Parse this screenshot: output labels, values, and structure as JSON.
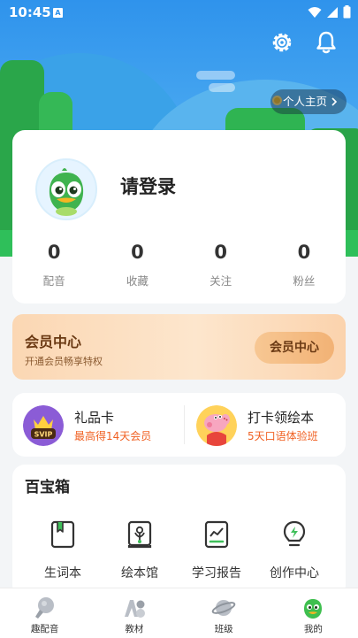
{
  "status_bar": {
    "time": "10:45",
    "sim_label": "A"
  },
  "header": {
    "home_link_label": "个人主页"
  },
  "profile": {
    "login_label": "请登录",
    "stats": [
      {
        "value": "0",
        "label": "配音"
      },
      {
        "value": "0",
        "label": "收藏"
      },
      {
        "value": "0",
        "label": "关注"
      },
      {
        "value": "0",
        "label": "粉丝"
      }
    ]
  },
  "vip": {
    "title": "会员中心",
    "subtitle": "开通会员畅享特权",
    "button_label": "会员中心"
  },
  "promo": {
    "gift": {
      "title": "礼品卡",
      "subtitle": "最高得14天会员",
      "badge": "SVIP"
    },
    "checkin": {
      "title": "打卡领绘本",
      "subtitle": "5天口语体验班"
    }
  },
  "toolbox": {
    "title": "百宝箱",
    "items": [
      {
        "label": "生词本",
        "icon": "bookmark-book-icon"
      },
      {
        "label": "绘本馆",
        "icon": "flower-book-icon"
      },
      {
        "label": "学习报告",
        "icon": "report-icon"
      },
      {
        "label": "创作中心",
        "icon": "lightbulb-icon"
      }
    ]
  },
  "tabbar": {
    "items": [
      {
        "label": "趣配音",
        "icon": "microphone-icon"
      },
      {
        "label": "教材",
        "icon": "abc-icon"
      },
      {
        "label": "班级",
        "icon": "planet-icon"
      },
      {
        "label": "我的",
        "icon": "bird-icon"
      }
    ]
  },
  "colors": {
    "sky": "#2f93ec",
    "grass": "#2fbf5a",
    "accent_orange": "#f06022",
    "vip_brown": "#6b3a14"
  }
}
